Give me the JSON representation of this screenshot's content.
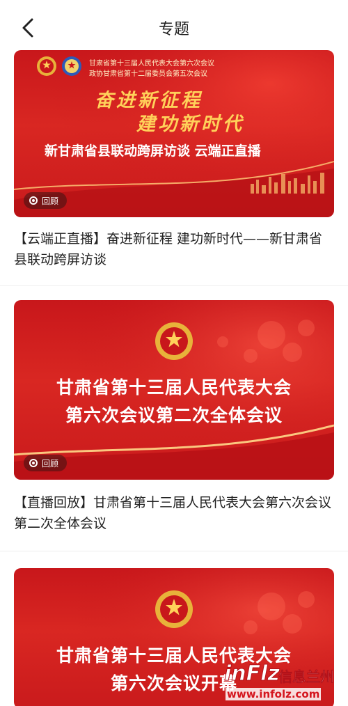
{
  "header": {
    "title": "专题",
    "back_icon": "chevron-left-icon"
  },
  "cards": [
    {
      "banner": {
        "small_lines": [
          "甘肃省第十三届人民代表大会第六次会议",
          "政协甘肃省第十二届委员会第五次会议"
        ],
        "calligraphy": [
          "奋进新征程",
          "建功新时代"
        ],
        "headline": "新甘肃省县联动跨屏访谈  云端正直播",
        "badge": "回顾"
      },
      "caption": "【云端正直播】奋进新征程  建功新时代——新甘肃省县联动跨屏访谈"
    },
    {
      "banner": {
        "title_lines": [
          "甘肃省第十三届人民代表大会",
          "第六次会议第二次全体会议"
        ],
        "badge": "回顾"
      },
      "caption": "【直播回放】甘肃省第十三届人民代表大会第六次会议第二次全体会议"
    },
    {
      "banner": {
        "title_lines": [
          "甘肃省第十三届人民代表大会",
          "第六次会议开幕"
        ]
      }
    }
  ],
  "watermark": {
    "logo": "inFlz",
    "brand": "信息兰州",
    "url": "www.infolz.com"
  },
  "colors": {
    "banner_red": "#d92722",
    "gold": "#ffd15a",
    "text": "#222222"
  }
}
